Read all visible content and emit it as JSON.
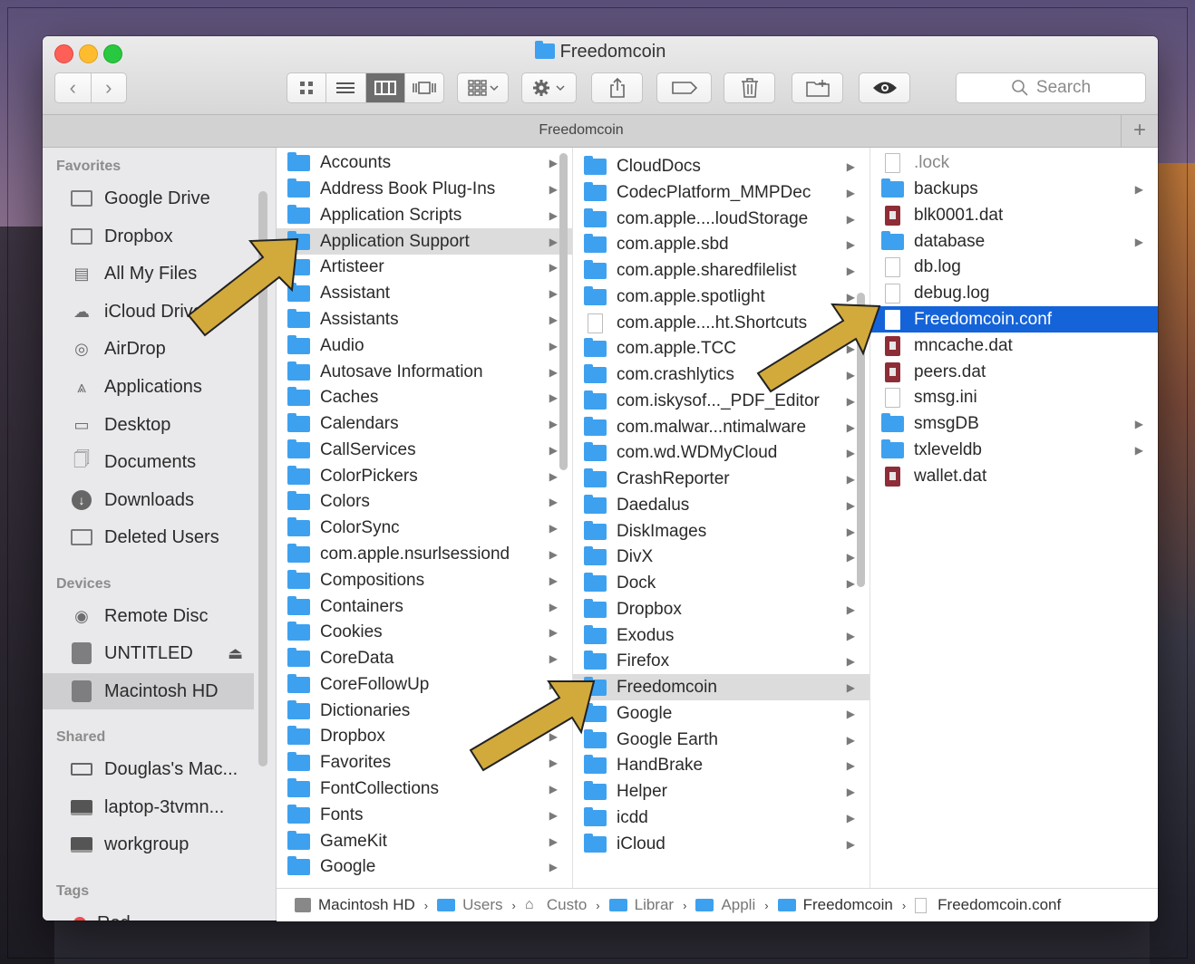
{
  "window": {
    "title": "Freedomcoin",
    "tab_title": "Freedomcoin",
    "search_placeholder": "Search"
  },
  "toolbar": {
    "back": "‹",
    "forward": "›",
    "plus": "+"
  },
  "sidebar": {
    "favorites_header": "Favorites",
    "favorites": [
      {
        "label": "Google Drive",
        "icon": "folder-icon"
      },
      {
        "label": "Dropbox",
        "icon": "folder-icon"
      },
      {
        "label": "All My Files",
        "icon": "all-files-icon"
      },
      {
        "label": "iCloud Drive",
        "icon": "cloud-icon"
      },
      {
        "label": "AirDrop",
        "icon": "airdrop-icon"
      },
      {
        "label": "Applications",
        "icon": "applications-icon"
      },
      {
        "label": "Desktop",
        "icon": "desktop-icon"
      },
      {
        "label": "Documents",
        "icon": "documents-icon"
      },
      {
        "label": "Downloads",
        "icon": "downloads-icon"
      },
      {
        "label": "Deleted Users",
        "icon": "folder-icon"
      }
    ],
    "devices_header": "Devices",
    "devices": [
      {
        "label": "Remote Disc",
        "icon": "disc-icon"
      },
      {
        "label": "UNTITLED",
        "icon": "drive-icon"
      },
      {
        "label": "Macintosh HD",
        "icon": "drive-icon"
      }
    ],
    "shared_header": "Shared",
    "shared": [
      {
        "label": "Douglas's Mac...",
        "icon": "laptop-icon"
      },
      {
        "label": "laptop-3tvmn...",
        "icon": "monitor-icon"
      },
      {
        "label": "workgroup",
        "icon": "monitor-icon"
      }
    ],
    "tags_header": "Tags",
    "tags": [
      {
        "label": "Red"
      }
    ]
  },
  "columns": {
    "col1": [
      "Accounts",
      "Address Book Plug-Ins",
      "Application Scripts",
      "Application Support",
      "Artisteer",
      "Assistant",
      "Assistants",
      "Audio",
      "Autosave Information",
      "Caches",
      "Calendars",
      "CallServices",
      "ColorPickers",
      "Colors",
      "ColorSync",
      "com.apple.nsurlsessiond",
      "Compositions",
      "Containers",
      "Cookies",
      "CoreData",
      "CoreFollowUp",
      "Dictionaries",
      "Dropbox",
      "Favorites",
      "FontCollections",
      "Fonts",
      "GameKit",
      "Google"
    ],
    "col2": [
      "CloudDocs",
      "CodecPlatform_MMPDec",
      "com.apple....loudStorage",
      "com.apple.sbd",
      "com.apple.sharedfilelist",
      "com.apple.spotlight",
      "com.apple....ht.Shortcuts",
      "com.apple.TCC",
      "com.crashlytics",
      "com.iskysof..._PDF_Editor",
      "com.malwar...ntimalware",
      "com.wd.WDMyCloud",
      "CrashReporter",
      "Daedalus",
      "DiskImages",
      "DivX",
      "Dock",
      "Dropbox",
      "Exodus",
      "Firefox",
      "Freedomcoin",
      "Google",
      "Google Earth",
      "HandBrake",
      "Helper",
      "icdd",
      "iCloud"
    ],
    "col3": [
      ".lock",
      "backups",
      "blk0001.dat",
      "database",
      "db.log",
      "debug.log",
      "Freedomcoin.conf",
      "mncache.dat",
      "peers.dat",
      "smsg.ini",
      "smsgDB",
      "txleveldb",
      "wallet.dat"
    ]
  },
  "pathbar": [
    "Macintosh HD",
    "Users",
    "Custo",
    "Librar",
    "Appli",
    "Freedomcoin",
    "Freedomcoin.conf"
  ]
}
